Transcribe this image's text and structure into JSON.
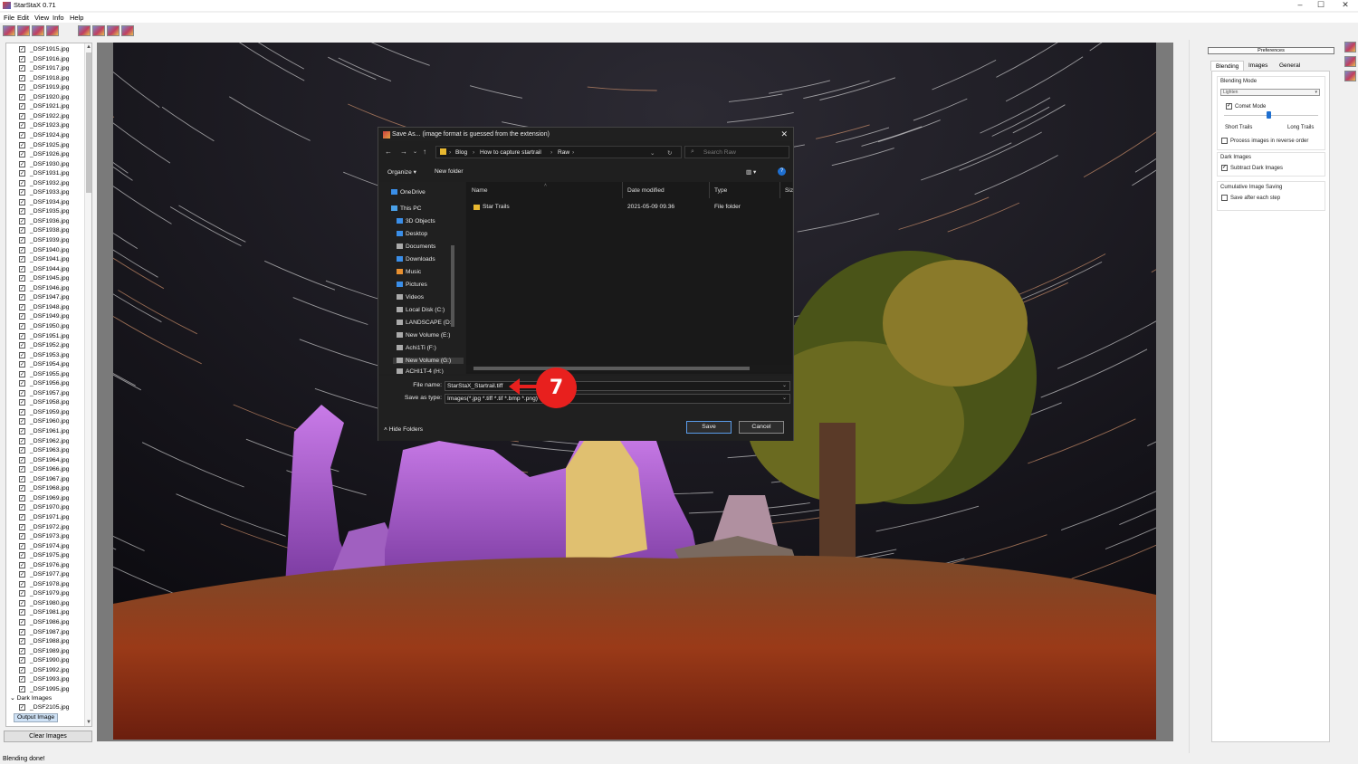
{
  "window": {
    "title": "StarStaX 0.71"
  },
  "menu": [
    "File",
    "Edit",
    "View",
    "Info",
    "Help"
  ],
  "file_list": {
    "files": [
      "_DSF1915.jpg",
      "_DSF1916.jpg",
      "_DSF1917.jpg",
      "_DSF1918.jpg",
      "_DSF1919.jpg",
      "_DSF1920.jpg",
      "_DSF1921.jpg",
      "_DSF1922.jpg",
      "_DSF1923.jpg",
      "_DSF1924.jpg",
      "_DSF1925.jpg",
      "_DSF1926.jpg",
      "_DSF1930.jpg",
      "_DSF1931.jpg",
      "_DSF1932.jpg",
      "_DSF1933.jpg",
      "_DSF1934.jpg",
      "_DSF1935.jpg",
      "_DSF1936.jpg",
      "_DSF1938.jpg",
      "_DSF1939.jpg",
      "_DSF1940.jpg",
      "_DSF1941.jpg",
      "_DSF1944.jpg",
      "_DSF1945.jpg",
      "_DSF1946.jpg",
      "_DSF1947.jpg",
      "_DSF1948.jpg",
      "_DSF1949.jpg",
      "_DSF1950.jpg",
      "_DSF1951.jpg",
      "_DSF1952.jpg",
      "_DSF1953.jpg",
      "_DSF1954.jpg",
      "_DSF1955.jpg",
      "_DSF1956.jpg",
      "_DSF1957.jpg",
      "_DSF1958.jpg",
      "_DSF1959.jpg",
      "_DSF1960.jpg",
      "_DSF1961.jpg",
      "_DSF1962.jpg",
      "_DSF1963.jpg",
      "_DSF1964.jpg",
      "_DSF1966.jpg",
      "_DSF1967.jpg",
      "_DSF1968.jpg",
      "_DSF1969.jpg",
      "_DSF1970.jpg",
      "_DSF1971.jpg",
      "_DSF1972.jpg",
      "_DSF1973.jpg",
      "_DSF1974.jpg",
      "_DSF1975.jpg",
      "_DSF1976.jpg",
      "_DSF1977.jpg",
      "_DSF1978.jpg",
      "_DSF1979.jpg",
      "_DSF1980.jpg",
      "_DSF1981.jpg",
      "_DSF1986.jpg",
      "_DSF1987.jpg",
      "_DSF1988.jpg",
      "_DSF1989.jpg",
      "_DSF1990.jpg",
      "_DSF1992.jpg",
      "_DSF1993.jpg",
      "_DSF1995.jpg"
    ],
    "dark_images_label": "Dark Images",
    "dark_files": [
      "_DSF2105.jpg"
    ],
    "output_image_label": "Output Image",
    "clear_button": "Clear Images"
  },
  "preferences": {
    "button": "Preferences",
    "tabs": [
      "Blending",
      "Images",
      "General"
    ],
    "blending_mode_label": "Blending Mode",
    "blending_mode_value": "Lighten",
    "comet_mode_label": "Comet Mode",
    "comet_mode_checked": true,
    "short_trails_label": "Short Trails",
    "long_trails_label": "Long Trails",
    "trail_slider_value": 0.47,
    "reverse_order_label": "Process images in reverse order",
    "reverse_order_checked": false,
    "dark_images_section": "Dark Images",
    "subtract_dark_label": "Subtract Dark Images",
    "subtract_dark_checked": true,
    "cumulative_section": "Cumulative Image Saving",
    "save_each_step_label": "Save after each step",
    "save_each_step_checked": false
  },
  "status": "Blending done!",
  "dialog": {
    "title": "Save As... (image format is guessed from the extension)",
    "breadcrumbs": [
      "Blog",
      "How to capture startrail",
      "Raw"
    ],
    "search_placeholder": "Search Raw",
    "organize": "Organize",
    "new_folder": "New folder",
    "help": "?",
    "nav_items": [
      "OneDrive",
      "This PC",
      "3D Objects",
      "Desktop",
      "Documents",
      "Downloads",
      "Music",
      "Pictures",
      "Videos",
      "Local Disk (C:)",
      "LANDSCAPE (D:)",
      "New Volume (E:)",
      "Achi1Ti (F:)",
      "New Volume (G:)",
      "ACHI1T-4 (H:)"
    ],
    "columns": [
      "Name",
      "Date modified",
      "Type",
      "Siz"
    ],
    "rows": [
      {
        "name": "Star Trails",
        "date": "2021-05-09 09.36",
        "type": "File folder"
      }
    ],
    "file_name_label": "File name:",
    "file_name_value": "StarStaX_Startrail.tiff",
    "save_type_label": "Save as type:",
    "save_type_value": "Images(*.jpg *.tiff *.tif *.bmp *.png)",
    "hide_folders": "Hide Folders",
    "save_button": "Save",
    "cancel_button": "Cancel"
  },
  "callout": {
    "number": "7",
    "color": "#e8201e"
  },
  "colors": {
    "accent": "#1e6fd0",
    "dialog_bg": "#1f1f1f"
  }
}
